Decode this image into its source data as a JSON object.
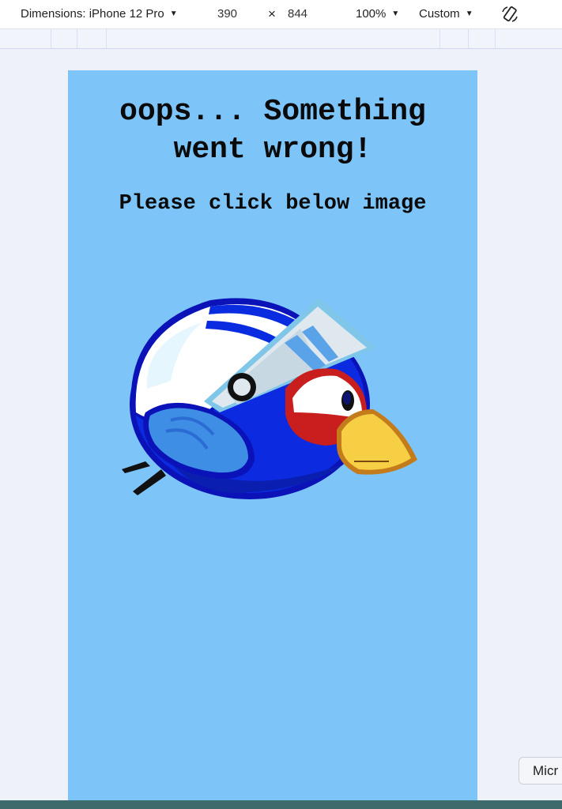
{
  "toolbar": {
    "device_label": "Dimensions: iPhone 12 Pro",
    "width_value": "390",
    "times_symbol": "×",
    "height_value": "844",
    "zoom_label": "100%",
    "throttle_label": "Custom",
    "rotate_icon": "rotate-device-icon"
  },
  "page": {
    "title_line1": "oops... Something",
    "title_line2": "went wrong!",
    "subtitle": "Please click below image",
    "image": "blue-bird-helmet-illustration"
  },
  "side_button": {
    "label": "Micr"
  },
  "colors": {
    "viewport_bg": "#7dc4f8",
    "canvas_bg": "#eef1f8",
    "bird_blue": "#0b1ed8",
    "beak": "#f6cf45"
  }
}
